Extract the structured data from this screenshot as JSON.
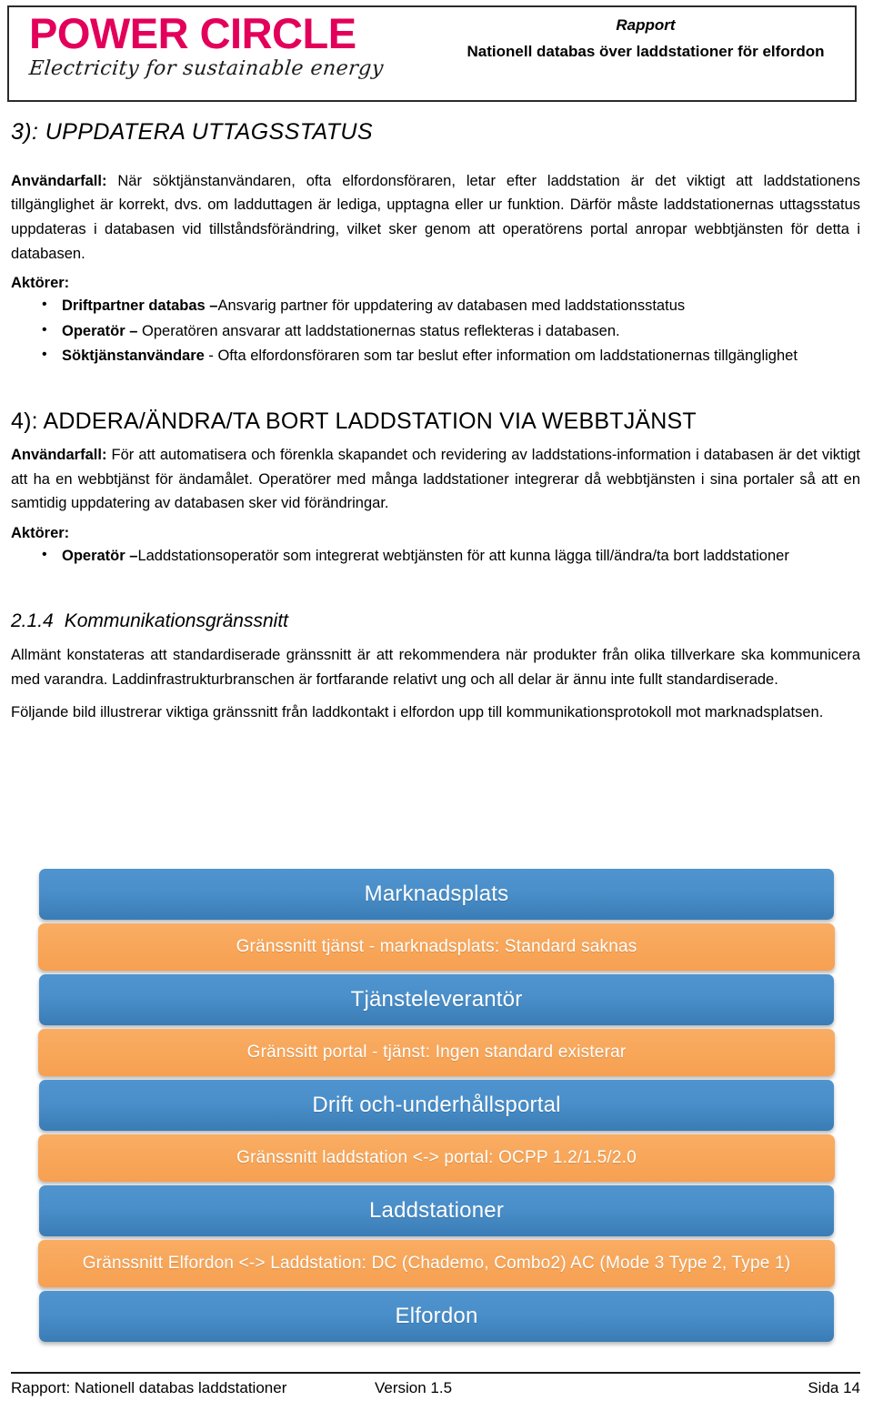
{
  "header": {
    "logo_wordmark": "POWER CIRCLE",
    "logo_tagline": "Electricity for sustainable energy",
    "kicker": "Rapport",
    "title": "Nationell databas över laddstationer för elfordon"
  },
  "section_3": {
    "heading": "3): UPPDATERA UTTAGSSTATUS",
    "usecase_label": "Användarfall:",
    "usecase_text": " När söktjänstanvändaren, ofta elfordonsföraren, letar efter laddstation är det viktigt att laddstationens tillgänglighet är korrekt, dvs. om ladduttagen är lediga, upptagna eller ur funktion. Därför måste laddstationernas uttagsstatus uppdateras i databasen vid tillståndsförändring, vilket sker genom att operatörens portal anropar webbtjänsten för detta i databasen.",
    "actors_label": "Aktörer:",
    "actors": [
      {
        "bold": "Driftpartner databas –",
        "rest": "Ansvarig partner för uppdatering av databasen med laddstationsstatus"
      },
      {
        "bold": "Operatör –",
        "rest": " Operatören ansvarar att laddstationernas status reflekteras i databasen."
      },
      {
        "bold": "Söktjänstanvändare",
        "rest": " - Ofta elfordonsföraren som tar beslut efter information om laddstationernas tillgänglighet"
      }
    ]
  },
  "section_4": {
    "heading": "4): ADDERA/ÄNDRA/TA BORT LADDSTATION VIA WEBBTJÄNST",
    "usecase_label": "Användarfall:",
    "usecase_text": " För att automatisera och förenkla skapandet och revidering av laddstations-information i databasen är det viktigt att ha en webbtjänst för ändamålet. Operatörer med många laddstationer integrerar då webbtjänsten i sina portaler så att en samtidig uppdatering av databasen sker vid förändringar.",
    "actors_label": "Aktörer:",
    "actors": [
      {
        "bold": "Operatör –",
        "rest": "Laddstationsoperatör som integrerat webtjänsten för att kunna lägga till/ändra/ta bort laddstationer"
      }
    ]
  },
  "section_214": {
    "number": "2.1.4",
    "title": "Kommunikationsgränssnitt",
    "para1": "Allmänt konstateras att standardiserade gränssnitt är att rekommendera när produkter från olika tillverkare ska kommunicera med varandra. Laddinfrastrukturbranschen är fortfarande relativt ung och all delar är ännu inte fullt standardiserade.",
    "para2": "Följande bild illustrerar viktiga gränssnitt från laddkontakt i elfordon upp till kommunikationsprotokoll mot marknadsplatsen."
  },
  "diagram": {
    "colors": {
      "role_blue": "#4a8fca",
      "interface_orange": "#f8a558",
      "label_text": "#ffffff"
    },
    "bars": [
      {
        "type": "role",
        "label": "Marknadsplats"
      },
      {
        "type": "iface",
        "label": "Gränssnitt tjänst - marknadsplats: Standard saknas"
      },
      {
        "type": "role",
        "label": "Tjänsteleverantör"
      },
      {
        "type": "iface",
        "label": "Gränssitt portal - tjänst: Ingen standard existerar"
      },
      {
        "type": "role",
        "label": "Drift och-underhållsportal"
      },
      {
        "type": "iface",
        "label": "Gränssnitt laddstation <-> portal: OCPP 1.2/1.5/2.0"
      },
      {
        "type": "role",
        "label": "Laddstationer"
      },
      {
        "type": "iface",
        "label": "Gränssnitt Elfordon <-> Laddstation: DC (Chademo, Combo2) AC (Mode 3 Type 2, Type 1)"
      },
      {
        "type": "role",
        "label": "Elfordon"
      }
    ]
  },
  "footer": {
    "left": "Rapport: Nationell databas laddstationer",
    "middle": "Version 1.5",
    "right": "Sida 14"
  }
}
